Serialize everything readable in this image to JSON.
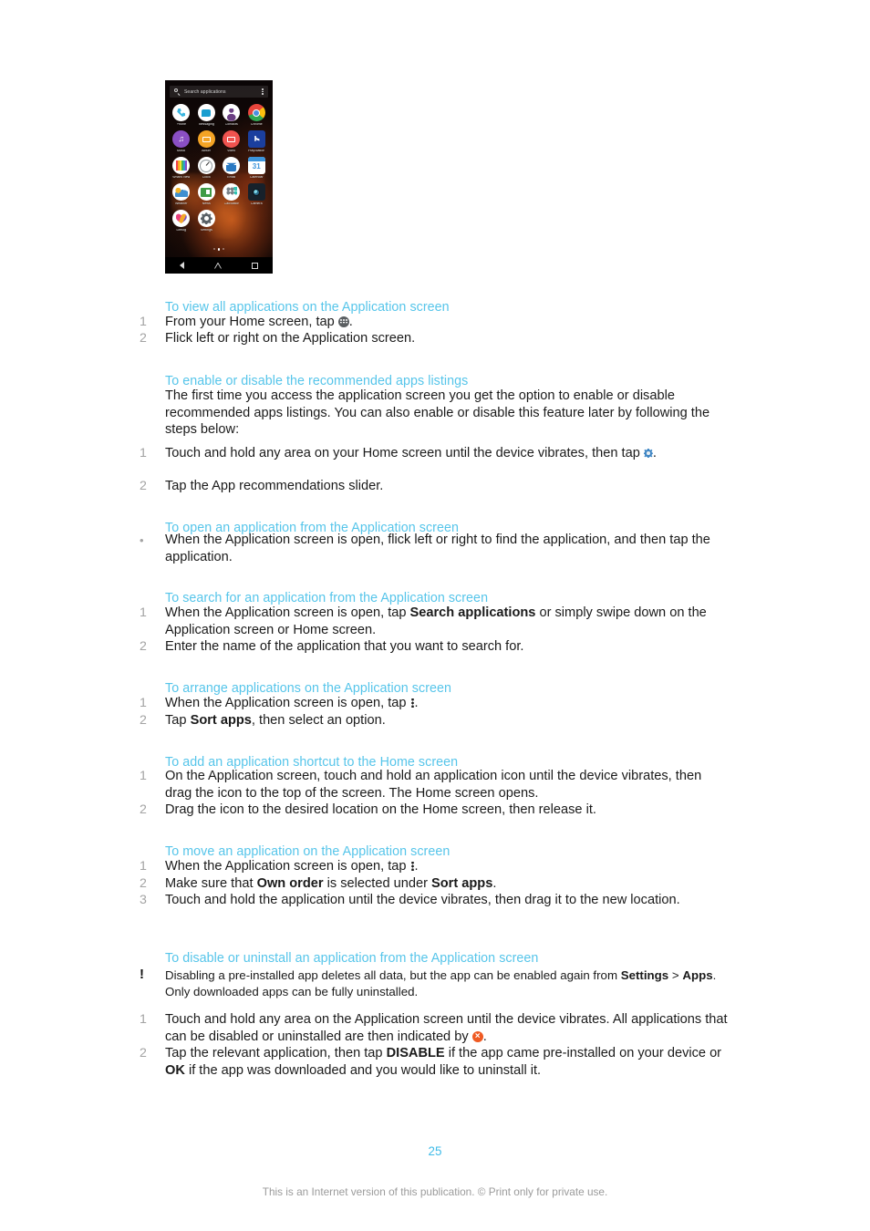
{
  "document": {
    "page_number": "25",
    "footer_note": "This is an Internet version of this publication. © Print only for private use."
  },
  "figure": {
    "name": "application-screen-screenshot",
    "search_placeholder": "Search applications",
    "overflow_icon": "more-vertical-icon",
    "search_icon": "search-icon",
    "page_indicator": {
      "count": 3,
      "active_index": 1
    },
    "nav_bar": [
      "back-icon",
      "home-icon",
      "recents-icon"
    ],
    "apps": [
      {
        "label": "Phone",
        "icon": "phone-icon"
      },
      {
        "label": "Messaging",
        "icon": "messaging-icon"
      },
      {
        "label": "Contacts",
        "icon": "contacts-icon"
      },
      {
        "label": "Chrome",
        "icon": "chrome-icon"
      },
      {
        "label": "Music",
        "icon": "music-icon"
      },
      {
        "label": "Album",
        "icon": "album-icon"
      },
      {
        "label": "Video",
        "icon": "video-icon"
      },
      {
        "label": "PlayStation",
        "icon": "playstation-icon"
      },
      {
        "label": "What's New",
        "icon": "whats-new-icon"
      },
      {
        "label": "Clock",
        "icon": "clock-icon"
      },
      {
        "label": "Email",
        "icon": "email-icon"
      },
      {
        "label": "Calendar",
        "icon": "calendar-icon",
        "badge_day": "31"
      },
      {
        "label": "Weather",
        "icon": "weather-icon"
      },
      {
        "label": "News",
        "icon": "news-icon"
      },
      {
        "label": "Calculator",
        "icon": "calculator-icon"
      },
      {
        "label": "Camera",
        "icon": "camera-icon"
      },
      {
        "label": "Lifelog",
        "icon": "lifelog-icon"
      },
      {
        "label": "Settings",
        "icon": "settings-icon"
      }
    ]
  },
  "colors": {
    "heading": "#56c5ea",
    "marker": "#a3a3a3",
    "body": "#1a1a1a",
    "page_number": "#3fbbe8",
    "footer": "#9b9b9b",
    "disable_badge": "#ef5a22"
  },
  "sections": [
    {
      "heading": "To view all applications on the Application screen",
      "steps": [
        {
          "marker": "1",
          "text_before": "From your Home screen, tap ",
          "icon": "app-grid-icon",
          "text_after": "."
        },
        {
          "marker": "2",
          "text": "Flick left or right on the Application screen."
        }
      ]
    },
    {
      "heading": "To enable or disable the recommended apps listings",
      "intro": "The first time you access the application screen you get the option to enable or disable recommended apps listings. You can also enable or disable this feature later by following the steps below:",
      "steps": [
        {
          "marker": "1",
          "text_before": "Touch and hold any area on your Home screen until the device vibrates, then tap ",
          "icon": "settings-dot-icon",
          "text_after": "."
        },
        {
          "marker": "2",
          "text": "Tap the App recommendations slider."
        }
      ]
    },
    {
      "heading": "To open an application from the Application screen",
      "steps": [
        {
          "marker": "•",
          "text": "When the Application screen is open, flick left or right to find the application, and then tap the application."
        }
      ]
    },
    {
      "heading": "To search for an application from the Application screen",
      "steps": [
        {
          "marker": "1",
          "text_before": "When the Application screen is open, tap ",
          "bold": "Search applications",
          "text_after": " or simply swipe down on the Application screen or Home screen."
        },
        {
          "marker": "2",
          "text": "Enter the name of the application that you want to search for."
        }
      ]
    },
    {
      "heading": "To arrange applications on the Application screen",
      "steps": [
        {
          "marker": "1",
          "text_before": "When the Application screen is open, tap ",
          "icon": "more-vertical-icon",
          "text_after": "."
        },
        {
          "marker": "2",
          "text_before": "Tap ",
          "bold": "Sort apps",
          "text_after": ", then select an option."
        }
      ]
    },
    {
      "heading": "To add an application shortcut to the Home screen",
      "steps": [
        {
          "marker": "1",
          "text": "On the Application screen, touch and hold an application icon until the device vibrates, then drag the icon to the top of the screen. The Home screen opens."
        },
        {
          "marker": "2",
          "text": "Drag the icon to the desired location on the Home screen, then release it."
        }
      ]
    },
    {
      "heading": "To move an application on the Application screen",
      "steps": [
        {
          "marker": "1",
          "text_before": "When the Application screen is open, tap ",
          "icon": "more-vertical-icon",
          "text_after": "."
        },
        {
          "marker": "2",
          "text_before": "Make sure that ",
          "bold": "Own order",
          "text_mid": " is selected under ",
          "bold2": "Sort apps",
          "text_after": "."
        },
        {
          "marker": "3",
          "text": "Touch and hold the application until the device vibrates, then drag it to the new location."
        }
      ]
    },
    {
      "heading": "To disable or uninstall an application from the Application screen",
      "note": {
        "marker": "!",
        "text_before": "Disabling a pre-installed app deletes all data, but the app can be enabled again from ",
        "bold": "Settings",
        "text_mid": " > ",
        "bold2": "Apps",
        "text_after": ". Only downloaded apps can be fully uninstalled."
      },
      "steps": [
        {
          "marker": "1",
          "text_before": "Touch and hold any area on the Application screen until the device vibrates. All applications that can be disabled or uninstalled are then indicated by ",
          "icon": "disable-badge-icon",
          "text_after": "."
        },
        {
          "marker": "2",
          "text_before": "Tap the relevant application, then tap ",
          "bold": "DISABLE",
          "text_mid": " if the app came pre-installed on your device or ",
          "bold2": "OK",
          "text_after": " if the app was downloaded and you would like to uninstall it."
        }
      ]
    }
  ]
}
